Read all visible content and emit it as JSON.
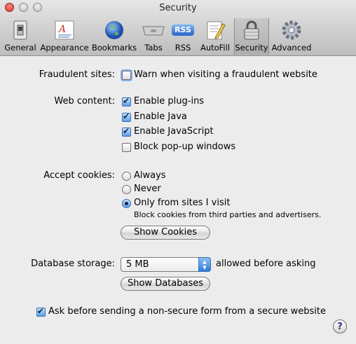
{
  "window": {
    "title": "Security"
  },
  "toolbar": {
    "items": [
      {
        "label": "General",
        "icon": "general-switch-icon"
      },
      {
        "label": "Appearance",
        "icon": "appearance-font-icon"
      },
      {
        "label": "Bookmarks",
        "icon": "bookmarks-globe-icon"
      },
      {
        "label": "Tabs",
        "icon": "tabs-icon"
      },
      {
        "label": "RSS",
        "icon": "rss-icon"
      },
      {
        "label": "AutoFill",
        "icon": "autofill-pencil-icon"
      },
      {
        "label": "Security",
        "icon": "security-lock-icon",
        "selected": true
      },
      {
        "label": "Advanced",
        "icon": "advanced-gear-icon"
      }
    ],
    "rss_badge": "RSS"
  },
  "fraudulent": {
    "label": "Fraudulent sites:",
    "option": "Warn when visiting a fraudulent website",
    "checked": false
  },
  "web_content": {
    "label": "Web content:",
    "options": [
      {
        "label": "Enable plug-ins",
        "checked": true
      },
      {
        "label": "Enable Java",
        "checked": true
      },
      {
        "label": "Enable JavaScript",
        "checked": true
      },
      {
        "label": "Block pop-up windows",
        "checked": false
      }
    ]
  },
  "cookies": {
    "label": "Accept cookies:",
    "options": [
      {
        "label": "Always",
        "selected": false
      },
      {
        "label": "Never",
        "selected": false
      },
      {
        "label": "Only from sites I visit",
        "selected": true
      }
    ],
    "hint": "Block cookies from third parties and advertisers.",
    "show_button": "Show Cookies"
  },
  "database": {
    "label": "Database storage:",
    "value": "5 MB",
    "suffix": "allowed before asking",
    "show_button": "Show Databases"
  },
  "nonsecure_form": {
    "label": "Ask before sending a non-secure form from a secure website",
    "checked": true
  },
  "help": {
    "glyph": "?"
  },
  "colors": {
    "accent": "#2f7bdc",
    "background": "#ececec"
  }
}
